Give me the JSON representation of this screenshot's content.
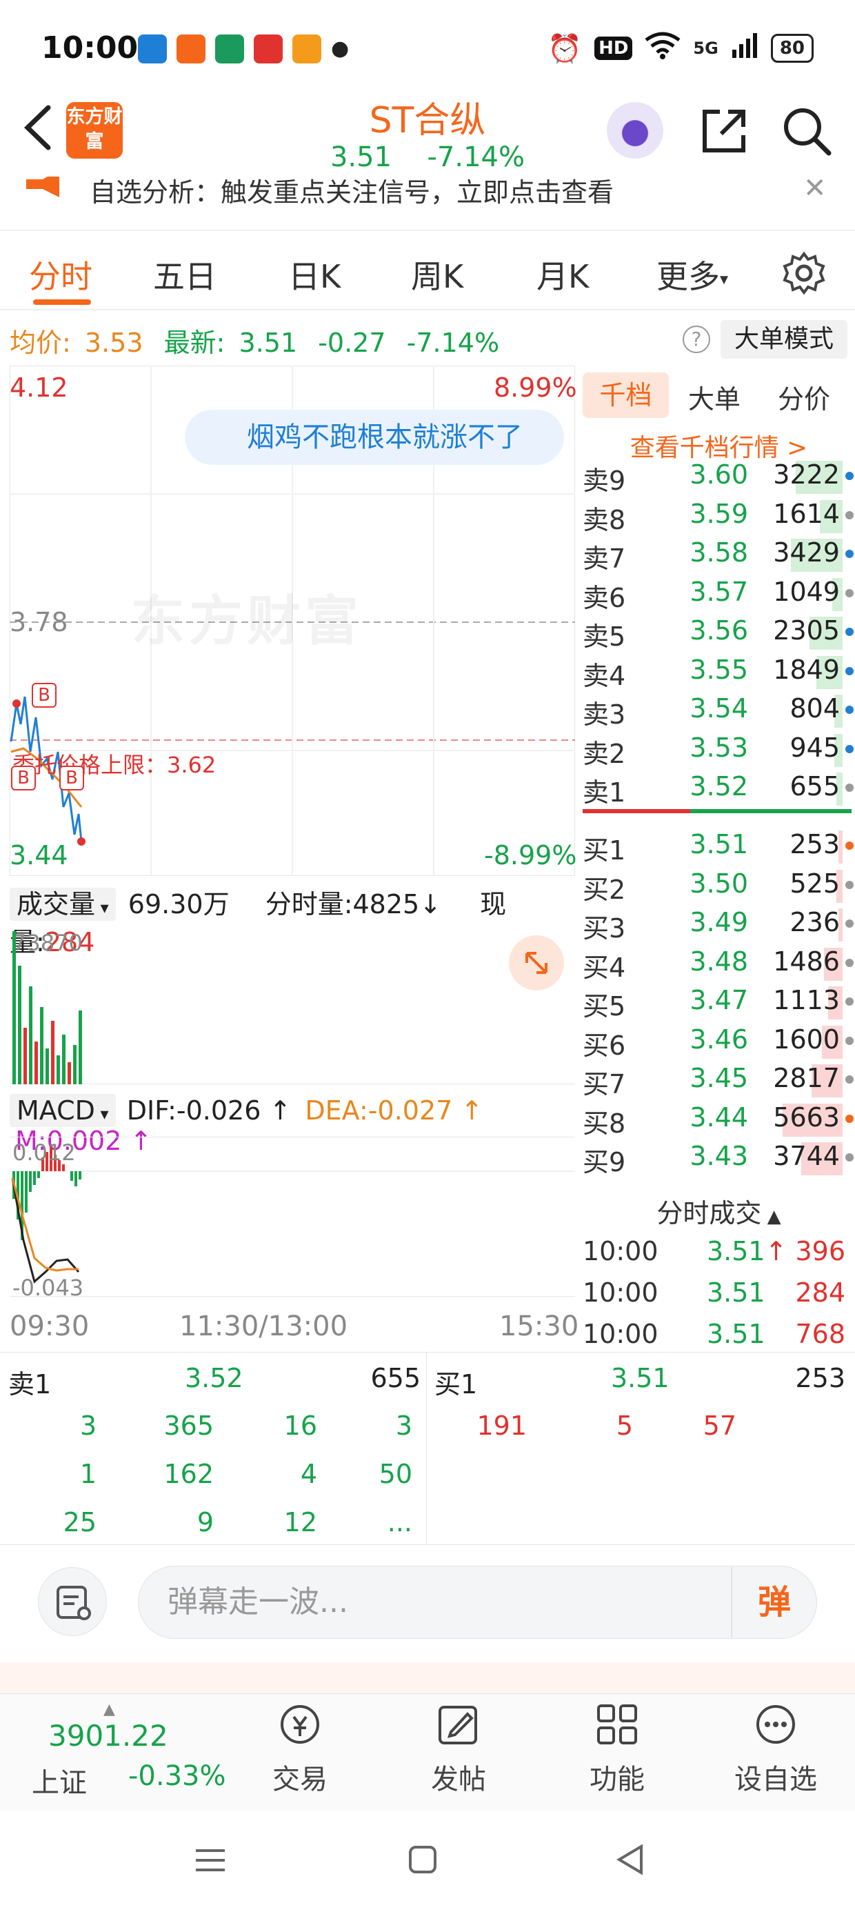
{
  "status": {
    "time": "10:00",
    "battery": "80",
    "net": "5G",
    "hd": "HD"
  },
  "header": {
    "logo": "东方财富",
    "name": "ST合纵",
    "price": "3.51",
    "change_pct": "-7.14%"
  },
  "notice": {
    "text": "自选分析：触发重点关注信号，立即点击查看"
  },
  "tabs": [
    "分时",
    "五日",
    "日K",
    "周K",
    "月K",
    "更多"
  ],
  "info_row": {
    "avg_label": "均价:",
    "avg_value": "3.53",
    "latest_label": "最新:",
    "latest_value": "3.51",
    "change": "-0.27",
    "change_pct": "-7.14%",
    "big_mode": "大单模式"
  },
  "chart": {
    "high": "4.12",
    "high_pct": "8.99%",
    "mid": "3.78",
    "low": "3.44",
    "low_pct": "-8.99%",
    "limit_label": "委托价格上限：3.62",
    "bubble_text": "烟鸡不跑根本就涨不了",
    "watermark": "东方财富",
    "vol_label": "成交量",
    "vol_total": "69.30万",
    "vol_period_label": "分时量:",
    "vol_period": "4825",
    "vol_now_label": "现量:",
    "vol_now": "284",
    "vol_axis": "73870",
    "macd_label": "MACD",
    "dif": "DIF:-0.026",
    "dea": "DEA:-0.027",
    "m": "M:0.002",
    "macd_top": "0.012",
    "macd_bottom": "-0.043",
    "t_start": "09:30",
    "t_mid": "11:30/13:00",
    "t_end": "15:30"
  },
  "orderbook": {
    "tabs": [
      "千档",
      "大单",
      "分价"
    ],
    "link": "查看千档行情 >",
    "asks": [
      {
        "name": "卖9",
        "price": "3.60",
        "vol": "3222",
        "bar": 0.45,
        "dot": "#1f7fd6"
      },
      {
        "name": "卖8",
        "price": "3.59",
        "vol": "1614",
        "bar": 0.22,
        "dot": "#999"
      },
      {
        "name": "卖7",
        "price": "3.58",
        "vol": "3429",
        "bar": 0.5,
        "dot": "#1f7fd6"
      },
      {
        "name": "卖6",
        "price": "3.57",
        "vol": "1049",
        "bar": 0.1,
        "dot": "#999"
      },
      {
        "name": "卖5",
        "price": "3.56",
        "vol": "2305",
        "bar": 0.32,
        "dot": "#1f7fd6"
      },
      {
        "name": "卖4",
        "price": "3.55",
        "vol": "1849",
        "bar": 0.25,
        "dot": "#1f7fd6"
      },
      {
        "name": "卖3",
        "price": "3.54",
        "vol": "804",
        "bar": 0.08,
        "dot": "#1f7fd6"
      },
      {
        "name": "卖2",
        "price": "3.53",
        "vol": "945",
        "bar": 0.08,
        "dot": "#1f7fd6"
      },
      {
        "name": "卖1",
        "price": "3.52",
        "vol": "655",
        "bar": 0.06,
        "dot": "#999"
      }
    ],
    "bids": [
      {
        "name": "买1",
        "price": "3.51",
        "vol": "253",
        "bar": 0.04,
        "dot": "#f5661b"
      },
      {
        "name": "买2",
        "price": "3.50",
        "vol": "525",
        "bar": 0.06,
        "dot": "#999"
      },
      {
        "name": "买3",
        "price": "3.49",
        "vol": "236",
        "bar": 0.04,
        "dot": "#999"
      },
      {
        "name": "买4",
        "price": "3.48",
        "vol": "1486",
        "bar": 0.18,
        "dot": "#999"
      },
      {
        "name": "买5",
        "price": "3.47",
        "vol": "1113",
        "bar": 0.14,
        "dot": "#999"
      },
      {
        "name": "买6",
        "price": "3.46",
        "vol": "1600",
        "bar": 0.2,
        "dot": "#999"
      },
      {
        "name": "买7",
        "price": "3.45",
        "vol": "2817",
        "bar": 0.3,
        "dot": "#999"
      },
      {
        "name": "买8",
        "price": "3.44",
        "vol": "5663",
        "bar": 0.58,
        "dot": "#f5661b"
      },
      {
        "name": "买9",
        "price": "3.43",
        "vol": "3744",
        "bar": 0.4,
        "dot": "#999"
      }
    ]
  },
  "time_sales": {
    "title": "分时成交",
    "rows": [
      {
        "t": "10:00",
        "p": "3.51",
        "v": "396",
        "arrow": "↑"
      },
      {
        "t": "10:00",
        "p": "3.51",
        "v": "284",
        "arrow": ""
      },
      {
        "t": "10:00",
        "p": "3.51",
        "v": "768",
        "arrow": ""
      }
    ]
  },
  "level2": {
    "sell_label": "卖1",
    "sell_price": "3.52",
    "sell_vol": "655",
    "buy_label": "买1",
    "buy_price": "3.51",
    "buy_vol": "253",
    "sell_queue": [
      [
        "3",
        "365",
        "16",
        "3"
      ],
      [
        "1",
        "162",
        "4",
        "50"
      ],
      [
        "25",
        "9",
        "12",
        "..."
      ]
    ],
    "buy_queue": [
      [
        "191",
        "5",
        "57"
      ]
    ]
  },
  "comment": {
    "placeholder": "弹幕走一波...",
    "dan": "弹"
  },
  "bottom_nav": {
    "index_value": "3901.22",
    "index_name": "上证",
    "index_change": "-0.33%",
    "items": [
      "交易",
      "发帖",
      "功能",
      "设自选"
    ]
  },
  "colors": {
    "brand": "#f5661b",
    "up": "#e0322f",
    "down": "#16a34a"
  }
}
